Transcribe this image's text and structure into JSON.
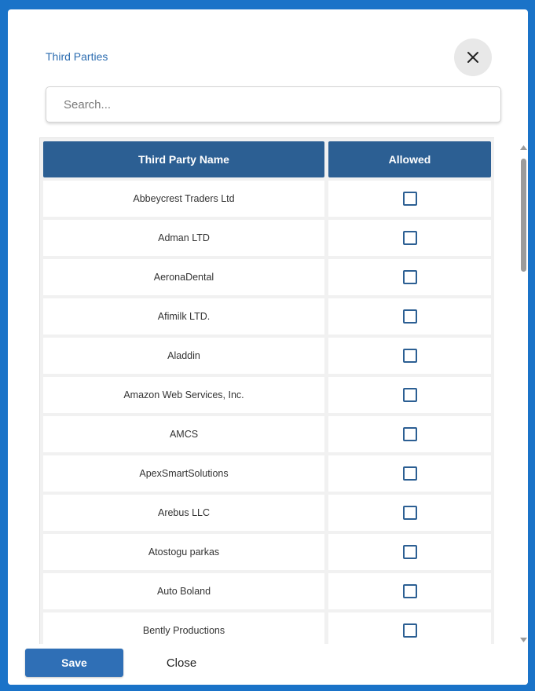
{
  "modal": {
    "title": "Third Parties",
    "close_icon": "close-icon"
  },
  "search": {
    "placeholder": "Search...",
    "value": ""
  },
  "table": {
    "headers": [
      "Third Party Name",
      "Allowed"
    ],
    "rows": [
      {
        "name": "Abbeycrest Traders Ltd",
        "allowed": false
      },
      {
        "name": "Adman LTD",
        "allowed": false
      },
      {
        "name": "AeronaDental",
        "allowed": false
      },
      {
        "name": "Afimilk LTD.",
        "allowed": false
      },
      {
        "name": "Aladdin",
        "allowed": false
      },
      {
        "name": "Amazon Web Services, Inc.",
        "allowed": false
      },
      {
        "name": "AMCS",
        "allowed": false
      },
      {
        "name": "ApexSmartSolutions",
        "allowed": false
      },
      {
        "name": "Arebus LLC",
        "allowed": false
      },
      {
        "name": "Atostogu parkas",
        "allowed": false
      },
      {
        "name": "Auto Boland",
        "allowed": false
      },
      {
        "name": "Bently Productions",
        "allowed": false
      }
    ]
  },
  "footer": {
    "save_label": "Save",
    "close_label": "Close"
  },
  "colors": {
    "background": "#1a73c8",
    "header": "#2c5f93",
    "title": "#2b6cb0",
    "save_button": "#2f6fb6"
  }
}
